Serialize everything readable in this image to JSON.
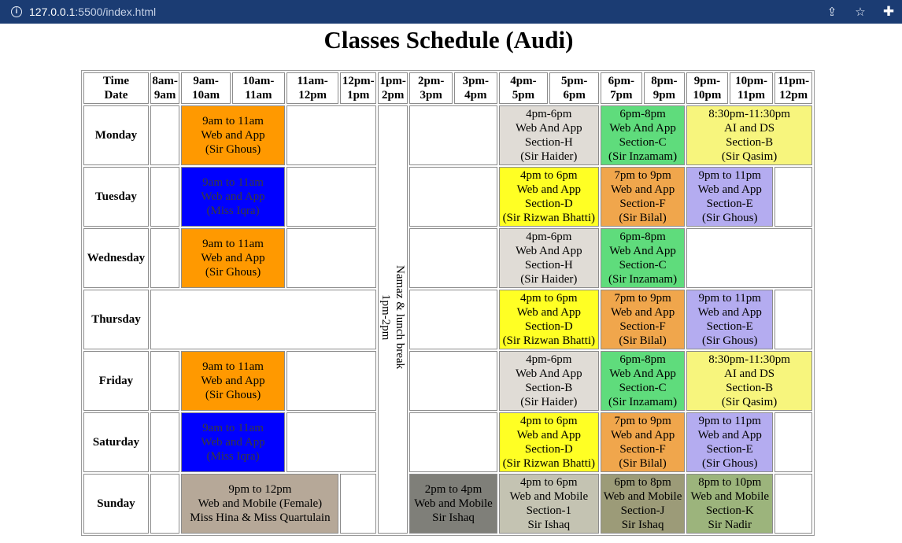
{
  "browser": {
    "url_host": "127.0.0.1",
    "url_rest": ":5500/index.html"
  },
  "title": "Classes Schedule (Audi)",
  "header": {
    "time_date": [
      "Time",
      "Date"
    ],
    "slots": [
      [
        "8am-",
        "9am"
      ],
      [
        "9am-",
        "10am"
      ],
      [
        "10am-",
        "11am"
      ],
      [
        "11am-",
        "12pm"
      ],
      [
        "12pm-",
        "1pm"
      ],
      [
        "1pm-",
        "2pm"
      ],
      [
        "2pm-",
        "3pm"
      ],
      [
        "3pm-",
        "4pm"
      ],
      [
        "4pm-",
        "5pm"
      ],
      [
        "5pm-",
        "6pm"
      ],
      [
        "6pm-",
        "7pm"
      ],
      [
        "8pm-",
        "9pm"
      ],
      [
        "9pm-",
        "10pm"
      ],
      [
        "10pm-",
        "11pm"
      ],
      [
        "11pm-",
        "12pm"
      ]
    ]
  },
  "break_text": [
    "Namaz & lunch break",
    "1pm-2pm"
  ],
  "colors": {
    "orange": "#ff9900",
    "blue": "#0000ff",
    "grey_light": "#e0dcd6",
    "green": "#5fdc7c",
    "yellow_light": "#f7f57d",
    "yellow": "#ffff24",
    "orange_light": "#f0a64c",
    "lavender": "#b4acf0",
    "tan": "#b6a898",
    "grey_dark": "#7f7f79",
    "khaki_light": "#c4c3b2",
    "olive": "#9c9b78",
    "sage": "#9cb47c"
  },
  "rows": [
    {
      "day": "Monday",
      "cells": [
        {
          "span": 1,
          "color": "",
          "lines": []
        },
        {
          "span": 2,
          "color": "orange",
          "lines": [
            "9am to 11am",
            "Web and App",
            "(Sir Ghous)"
          ]
        },
        {
          "span": 2,
          "color": "",
          "lines": []
        },
        {
          "break": true
        },
        {
          "span": 2,
          "color": "",
          "lines": []
        },
        {
          "span": 2,
          "color": "grey_light",
          "lines": [
            "4pm-6pm",
            "Web And App",
            "Section-H",
            "(Sir Haider)"
          ]
        },
        {
          "span": 2,
          "color": "green",
          "lines": [
            "6pm-8pm",
            "Web And App",
            "Section-C",
            "(Sir Inzamam)"
          ]
        },
        {
          "span": 3,
          "color": "yellow_light",
          "lines": [
            "8:30pm-11:30pm",
            "AI and DS",
            "Section-B",
            "(Sir Qasim)"
          ]
        }
      ]
    },
    {
      "day": "Tuesday",
      "cells": [
        {
          "span": 1,
          "color": "",
          "lines": []
        },
        {
          "span": 2,
          "color": "blue",
          "lines": [
            "9am to 11am",
            "Web and App",
            "(Miss Iqra)"
          ]
        },
        {
          "span": 2,
          "color": "",
          "lines": []
        },
        {
          "span": 2,
          "color": "",
          "lines": []
        },
        {
          "span": 2,
          "color": "yellow",
          "lines": [
            "4pm to 6pm",
            "Web and App",
            "Section-D",
            "(Sir Rizwan Bhatti)"
          ]
        },
        {
          "span": 2,
          "color": "orange_light",
          "lines": [
            "7pm to 9pm",
            "Web and App",
            "Section-F",
            "(Sir Bilal)"
          ]
        },
        {
          "span": 2,
          "color": "lavender",
          "lines": [
            "9pm to 11pm",
            "Web and App",
            "Section-E",
            "(Sir Ghous)"
          ]
        },
        {
          "span": 1,
          "color": "",
          "lines": []
        }
      ]
    },
    {
      "day": "Wednesday",
      "cells": [
        {
          "span": 1,
          "color": "",
          "lines": []
        },
        {
          "span": 2,
          "color": "orange",
          "lines": [
            "9am to 11am",
            "Web and App",
            "(Sir Ghous)"
          ]
        },
        {
          "span": 2,
          "color": "",
          "lines": []
        },
        {
          "span": 2,
          "color": "",
          "lines": []
        },
        {
          "span": 2,
          "color": "grey_light",
          "lines": [
            "4pm-6pm",
            "Web And App",
            "Section-H",
            "(Sir Haider)"
          ]
        },
        {
          "span": 2,
          "color": "green",
          "lines": [
            "6pm-8pm",
            "Web And App",
            "Section-C",
            "(Sir Inzamam)"
          ]
        },
        {
          "span": 3,
          "color": "",
          "lines": []
        }
      ]
    },
    {
      "day": "Thursday",
      "cells": [
        {
          "span": 5,
          "color": "",
          "lines": []
        },
        {
          "span": 2,
          "color": "",
          "lines": []
        },
        {
          "span": 2,
          "color": "yellow",
          "lines": [
            "4pm to 6pm",
            "Web and App",
            "Section-D",
            "(Sir Rizwan Bhatti)"
          ]
        },
        {
          "span": 2,
          "color": "orange_light",
          "lines": [
            "7pm to 9pm",
            "Web and App",
            "Section-F",
            "(Sir Bilal)"
          ]
        },
        {
          "span": 2,
          "color": "lavender",
          "lines": [
            "9pm to 11pm",
            "Web and App",
            "Section-E",
            "(Sir Ghous)"
          ]
        },
        {
          "span": 1,
          "color": "",
          "lines": []
        }
      ]
    },
    {
      "day": "Friday",
      "cells": [
        {
          "span": 1,
          "color": "",
          "lines": []
        },
        {
          "span": 2,
          "color": "orange",
          "lines": [
            "9am to 11am",
            "Web and App",
            "(Sir Ghous)"
          ]
        },
        {
          "span": 2,
          "color": "",
          "lines": []
        },
        {
          "span": 2,
          "color": "",
          "lines": []
        },
        {
          "span": 2,
          "color": "grey_light",
          "lines": [
            "4pm-6pm",
            "Web And App",
            "Section-B",
            "(Sir Haider)"
          ]
        },
        {
          "span": 2,
          "color": "green",
          "lines": [
            "6pm-8pm",
            "Web And App",
            "Section-C",
            "(Sir Inzamam)"
          ]
        },
        {
          "span": 3,
          "color": "yellow_light",
          "lines": [
            "8:30pm-11:30pm",
            "AI and DS",
            "Section-B",
            "(Sir Qasim)"
          ]
        }
      ]
    },
    {
      "day": "Saturday",
      "cells": [
        {
          "span": 1,
          "color": "",
          "lines": []
        },
        {
          "span": 2,
          "color": "blue",
          "lines": [
            "9am to 11am",
            "Web and App",
            "(Miss Iqra)"
          ]
        },
        {
          "span": 2,
          "color": "",
          "lines": []
        },
        {
          "span": 2,
          "color": "",
          "lines": []
        },
        {
          "span": 2,
          "color": "yellow",
          "lines": [
            "4pm to 6pm",
            "Web and App",
            "Section-D",
            "(Sir Rizwan Bhatti)"
          ]
        },
        {
          "span": 2,
          "color": "orange_light",
          "lines": [
            "7pm to 9pm",
            "Web and App",
            "Section-F",
            "(Sir Bilal)"
          ]
        },
        {
          "span": 2,
          "color": "lavender",
          "lines": [
            "9pm to 11pm",
            "Web and App",
            "Section-E",
            "(Sir Ghous)"
          ]
        },
        {
          "span": 1,
          "color": "",
          "lines": []
        }
      ]
    },
    {
      "day": "Sunday",
      "cells": [
        {
          "span": 1,
          "color": "",
          "lines": []
        },
        {
          "span": 3,
          "color": "tan",
          "lines": [
            "9pm to 12pm",
            "Web and Mobile (Female)",
            "Miss Hina & Miss Quartulain"
          ]
        },
        {
          "span": 1,
          "color": "",
          "lines": []
        },
        {
          "span": 2,
          "color": "grey_dark",
          "lines": [
            "2pm to 4pm",
            "Web and Mobile",
            "Sir Ishaq"
          ]
        },
        {
          "span": 2,
          "color": "khaki_light",
          "lines": [
            "4pm to 6pm",
            "Web and Mobile",
            "Section-1",
            "Sir Ishaq"
          ]
        },
        {
          "span": 2,
          "color": "olive",
          "lines": [
            "6pm to 8pm",
            "Web and Mobile",
            "Section-J",
            "Sir Ishaq"
          ]
        },
        {
          "span": 2,
          "color": "sage",
          "lines": [
            "8pm to 10pm",
            "Web and Mobile",
            "Section-K",
            "Sir Nadir"
          ]
        },
        {
          "span": 1,
          "color": "",
          "lines": []
        }
      ]
    }
  ]
}
